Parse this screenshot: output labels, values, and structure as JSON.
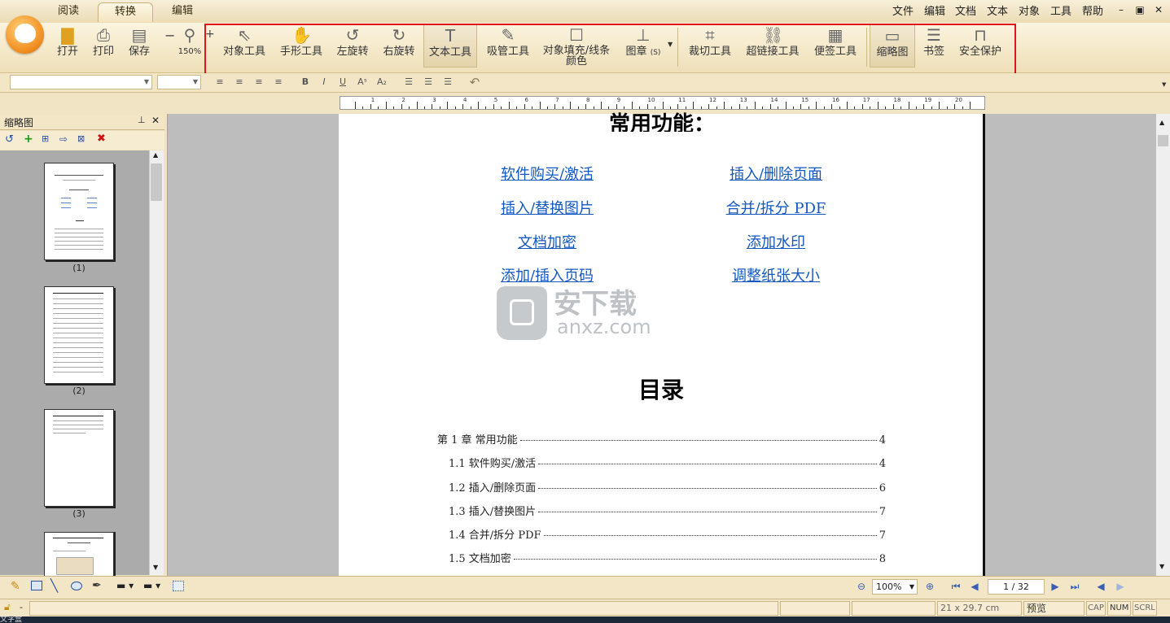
{
  "tabs": [
    "阅读",
    "转换",
    "编辑"
  ],
  "menu": [
    "文件",
    "编辑",
    "文档",
    "文本",
    "对象",
    "工具",
    "帮助"
  ],
  "ribbon": {
    "open": "打开",
    "print": "打印",
    "save": "保存",
    "zoom": "150%",
    "tools": [
      "对象工具",
      "手形工具",
      "左旋转",
      "右旋转",
      "文本工具",
      "吸管工具",
      "对象填充/线条颜色",
      "图章",
      "裁切工具",
      "超链接工具",
      "便签工具",
      "缩略图",
      "书签",
      "安全保护"
    ],
    "fill_line1": "对象填充/线条",
    "fill_line2": "颜色",
    "stamp_suffix": "(S)"
  },
  "sidebar": {
    "title": "缩略图",
    "thumbs": [
      "(1)",
      "(2)",
      "(3)"
    ]
  },
  "doc": {
    "heading": "常用功能：",
    "links_left": [
      "软件购买/激活",
      "插入/替换图片",
      "文档加密",
      "添加/插入页码 "
    ],
    "links_right": [
      "插入/删除页面",
      "合并/拆分 PDF",
      "添加水印",
      "调整纸张大小"
    ],
    "toc_title": "目录",
    "toc": [
      {
        "t": "第 1 章  常用功能",
        "p": "4"
      },
      {
        "t": "1.1 软件购买/激活",
        "p": "4"
      },
      {
        "t": "1.2 插入/删除页面",
        "p": "6"
      },
      {
        "t": "1.3 插入/替换图片",
        "p": "7"
      },
      {
        "t": "1.4 合并/拆分 PDF",
        "p": "7"
      },
      {
        "t": "1.5 文档加密",
        "p": "8"
      }
    ],
    "watermark": "安下载",
    "watermark_url": "anxz.com"
  },
  "bottom": {
    "zoom": "100%",
    "page": "1 / 32"
  },
  "status": {
    "size": "21 x 29.7 cm",
    "mode": "预览",
    "cap": "CAP",
    "num": "NUM",
    "scrl": "SCRL"
  },
  "ruler_labels": [
    "1",
    "2",
    "3",
    "4",
    "5",
    "6",
    "7",
    "8",
    "9",
    "10",
    "11",
    "12",
    "13",
    "14",
    "15",
    "16",
    "17",
    "18",
    "19",
    "20"
  ],
  "taskbar": "文字盒"
}
